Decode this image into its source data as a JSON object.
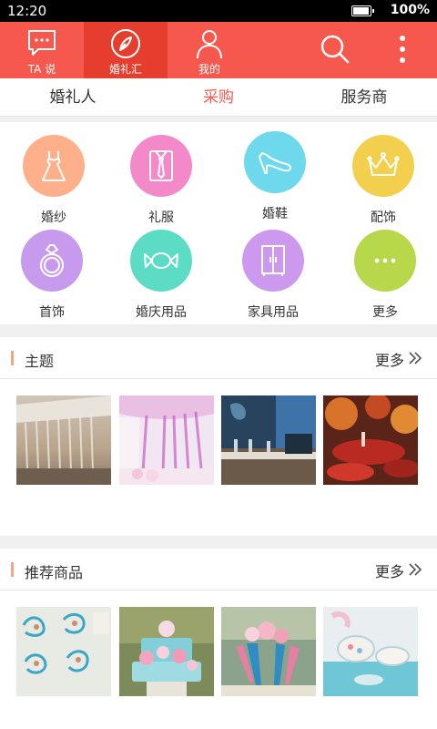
{
  "status_bar": {
    "time": "12:20",
    "battery": "100%",
    "battery_level": 1.0
  },
  "app_bar": {
    "nav": [
      {
        "label": "TA 说",
        "icon": "chat-bubble-icon"
      },
      {
        "label": "婚礼汇",
        "icon": "compass-icon"
      },
      {
        "label": "我的",
        "icon": "profile-icon"
      }
    ],
    "actions": [
      {
        "icon": "search-icon"
      },
      {
        "icon": "more-vertical-icon"
      }
    ]
  },
  "tabs": [
    "婚礼人",
    "采购",
    "服务商"
  ],
  "categories": [
    {
      "label": "婚纱",
      "icon": "wedding-dress-icon",
      "color": "#fdb08a"
    },
    {
      "label": "礼服",
      "icon": "suit-tie-icon",
      "color": "#f389c9"
    },
    {
      "label": "婚鞋",
      "icon": "high-heel-icon",
      "color": "#6ed8ec"
    },
    {
      "label": "配饰",
      "icon": "crown-icon",
      "color": "#f2d04e"
    },
    {
      "label": "首饰",
      "icon": "ring-icon",
      "color": "#c79aee"
    },
    {
      "label": "婚庆用品",
      "icon": "candy-icon",
      "color": "#5cdcc4"
    },
    {
      "label": "家具用品",
      "icon": "wardrobe-icon",
      "color": "#cc99ee"
    },
    {
      "label": "更多",
      "icon": "more-dots-icon",
      "color": "#b6d84a"
    }
  ],
  "sections": [
    {
      "title": "主题",
      "more": "更多"
    },
    {
      "title": "推荐商品",
      "more": "更多"
    }
  ],
  "colors": {
    "brand": "#f6584d",
    "brand_active": "#e53d2e",
    "section_bar": "#f6a37f"
  }
}
